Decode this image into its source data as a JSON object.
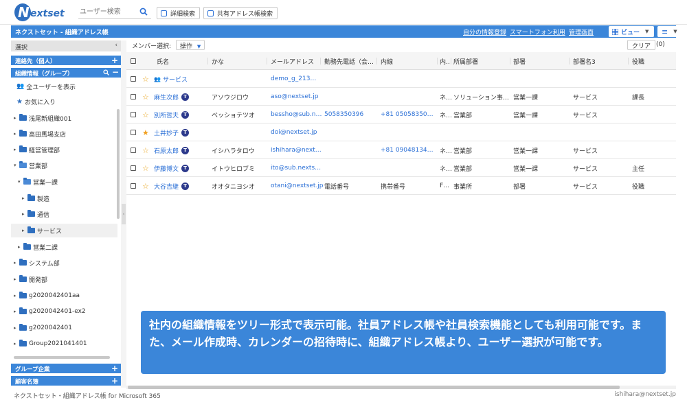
{
  "header": {
    "logo_text": "Nextset",
    "search_placeholder": "ユーザー検索",
    "detail_search": "詳細検索",
    "shared_book_search": "共有アドレス帳検索"
  },
  "bluebar": {
    "title": "ネクストセット - 組織アドレス帳",
    "link_profile": "自分の情報登録",
    "link_smartphone": "スマートフォン利用",
    "link_admin": "管理画面",
    "view_label": "ビュー"
  },
  "sidebar": {
    "select_label": "選択",
    "contacts_personal": "連絡先（個人）",
    "org_info_group": "組織情報（グループ）",
    "show_all_users": "全ユーザーを表示",
    "favorites": "お気に入り",
    "tree": [
      {
        "label": "浅尾新組織001"
      },
      {
        "label": "高田馬場支店"
      },
      {
        "label": "経営管理部"
      },
      {
        "label": "営業部"
      },
      {
        "label": "営業一課"
      },
      {
        "label": "製造"
      },
      {
        "label": "通信"
      },
      {
        "label": "サービス"
      },
      {
        "label": "営業二課"
      },
      {
        "label": "システム部"
      },
      {
        "label": "開発部"
      },
      {
        "label": "g2020042401aa"
      },
      {
        "label": "g2020042401-ex2"
      },
      {
        "label": "g2020042401"
      },
      {
        "label": "Group2021041401"
      }
    ],
    "group_company": "グループ企業",
    "customer_list": "顧客名簿"
  },
  "member_toolbar": {
    "select_label": "メンバー選択:",
    "operation": "操作",
    "clear": "クリア",
    "count": "(0)"
  },
  "table": {
    "columns": [
      "氏名",
      "かな",
      "メールアドレス",
      "勤務先電話（会…",
      "内線",
      "内…",
      "所属部署",
      "部署",
      "部署名3",
      "役職"
    ],
    "rows": [
      {
        "name": "サービス",
        "kana": "",
        "email": "demo_g_213…",
        "work_phone": "",
        "ext": "",
        "ext2": "",
        "dept_full": "",
        "dept": "",
        "dept3": "",
        "title": ""
      },
      {
        "name": "麻生次郎",
        "kana": "アソウジロウ",
        "email": "aso@nextset.jp",
        "work_phone": "",
        "ext": "",
        "ext2": "ネ…",
        "dept_full": "ソリューション事…",
        "dept": "営業一課",
        "dept3": "サービス",
        "title": "課長"
      },
      {
        "name": "別所哲夫",
        "kana": "ベッショテツオ",
        "email": "bessho@sub.n…",
        "work_phone": "5058350396",
        "ext": "+81 05058350…",
        "ext2": "ネ…",
        "dept_full": "営業部",
        "dept": "営業一課",
        "dept3": "サービス",
        "title": ""
      },
      {
        "name": "土井妙子",
        "kana": "",
        "email": "doi@nextset.jp",
        "work_phone": "",
        "ext": "",
        "ext2": "",
        "dept_full": "",
        "dept": "",
        "dept3": "",
        "title": ""
      },
      {
        "name": "石原太郎",
        "kana": "イシハラタロウ",
        "email": "ishihara@next…",
        "work_phone": "",
        "ext": "+81 09048134…",
        "ext2": "ネ…",
        "dept_full": "営業部",
        "dept": "営業一課",
        "dept3": "サービス",
        "title": ""
      },
      {
        "name": "伊藤博文",
        "kana": "イトウヒロブミ",
        "email": "ito@sub.nexts…",
        "work_phone": "",
        "ext": "",
        "ext2": "ネ…",
        "dept_full": "営業部",
        "dept": "営業一課",
        "dept3": "サービス",
        "title": "主任"
      },
      {
        "name": "大谷吉継",
        "kana": "オオタニヨシオ",
        "email": "otani@nextset.jp",
        "work_phone": "電話番号",
        "ext": "携帯番号",
        "ext2": "F…",
        "dept_full": "事業所",
        "dept": "部署",
        "dept3": "サービス",
        "title": "役職"
      }
    ],
    "badge_letter": "T"
  },
  "caption": "社内の組織情報をツリー形式で表示可能。社員アドレス帳や社員検索機能としても利用可能です。また、メール作成時、カレンダーの招待時に、組織アドレス帳より、ユーザー選択が可能です。",
  "footer": {
    "left": "ネクストセット・組織アドレス帳 for Microsoft 365",
    "right": "ishihara@nextset.jp"
  },
  "colors": {
    "accent": "#3b86d9",
    "link": "#2a6fd6",
    "star": "#e8a51f"
  }
}
